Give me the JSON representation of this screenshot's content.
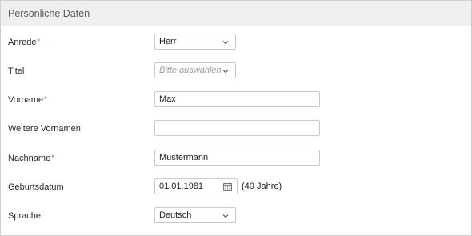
{
  "panel": {
    "title": "Persönliche Daten"
  },
  "fields": {
    "anrede": {
      "label": "Anrede",
      "required_mark": "*",
      "value": "Herr"
    },
    "titel": {
      "label": "Titel",
      "placeholder": "Bitte auswählen"
    },
    "vorname": {
      "label": "Vorname",
      "required_mark": "*",
      "value": "Max"
    },
    "weitere": {
      "label": "Weitere Vornamen",
      "value": ""
    },
    "nachname": {
      "label": "Nachname",
      "required_mark": "*",
      "value": "Mustermann"
    },
    "geburt": {
      "label": "Geburtsdatum",
      "value": "01.01.1981",
      "age_text": "(40 Jahre)"
    },
    "sprache": {
      "label": "Sprache",
      "value": "Deutsch"
    }
  },
  "icons": {
    "dropdown": "chevron-down-icon",
    "date": "calendar-icon"
  },
  "colors": {
    "header_bg": "#efefef",
    "required": "#d9534f",
    "border": "#c9c9c9"
  }
}
